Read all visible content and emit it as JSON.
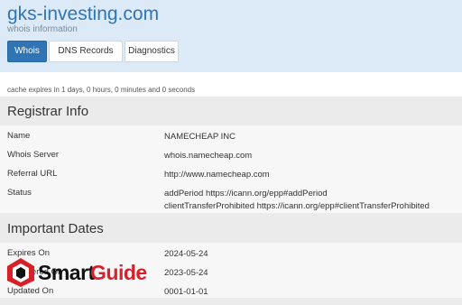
{
  "header": {
    "title": "gks-investing.com",
    "subtitle": "whois information"
  },
  "tabs": [
    {
      "label": "Whois",
      "active": true
    },
    {
      "label": "DNS Records",
      "active": false
    },
    {
      "label": "Diagnostics",
      "active": false
    }
  ],
  "cache": {
    "text": "cache expires in 1 days, 0 hours, 0 minutes and 0 seconds"
  },
  "registrar_info": {
    "heading": "Registrar Info",
    "rows": [
      {
        "label": "Name",
        "value": "NAMECHEAP INC"
      },
      {
        "label": "Whois Server",
        "value": "whois.namecheap.com"
      },
      {
        "label": "Referral URL",
        "value": "http://www.namecheap.com"
      },
      {
        "label": "Status",
        "value_line1": "addPeriod https://icann.org/epp#addPeriod",
        "value_line2": "clientTransferProhibited https://icann.org/epp#clientTransferProhibited"
      }
    ]
  },
  "important_dates": {
    "heading": "Important Dates",
    "rows": [
      {
        "label": "Expires On",
        "value": "2024-05-24"
      },
      {
        "label": "Registered On",
        "value": "2023-05-24"
      },
      {
        "label": "Updated On",
        "value": "0001-01-01"
      }
    ]
  },
  "watermark": {
    "text_dark": "Smart",
    "text_red": "Guide",
    "colors": {
      "dark": "#111111",
      "red": "#d8202a"
    }
  },
  "colors": {
    "accent": "#2f75b5",
    "header_bg": "#dbeaf6",
    "section_bg": "#ebebeb"
  }
}
